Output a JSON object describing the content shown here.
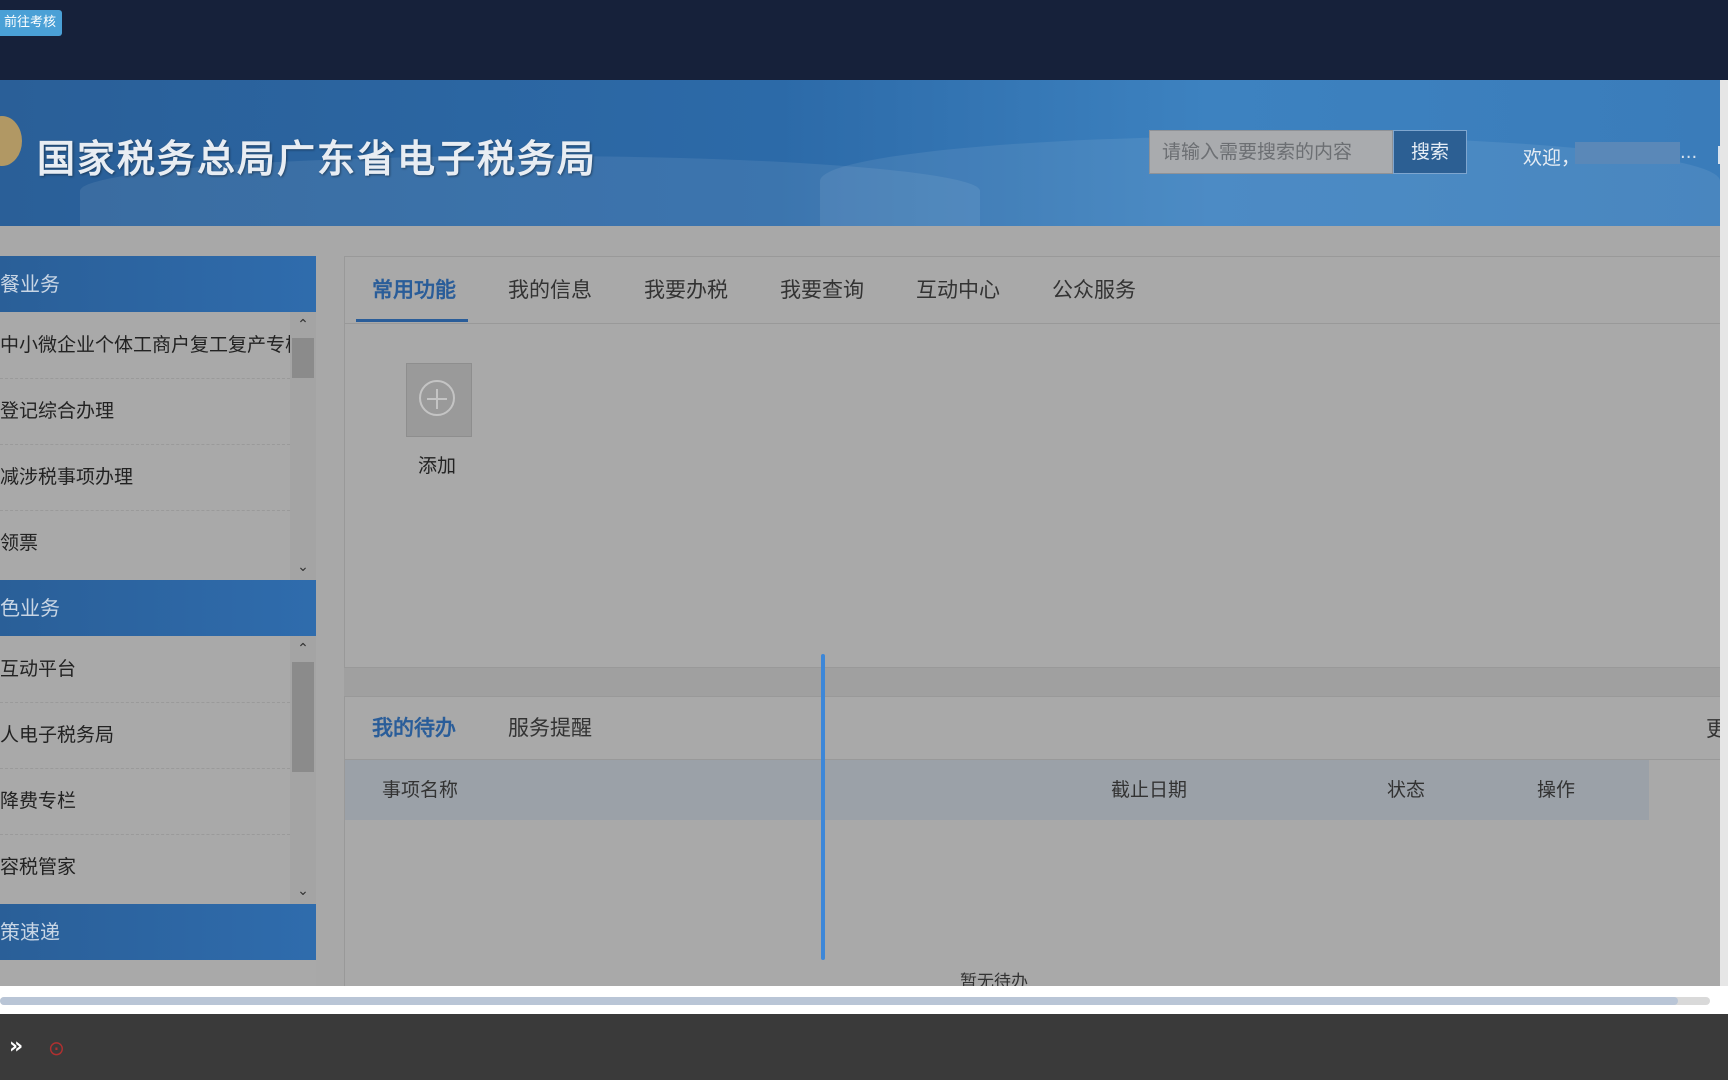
{
  "topbar": {
    "exam_button": "前往考核"
  },
  "header": {
    "site_title": "国家税务总局广东省电子税务局",
    "search_placeholder": "请输入需要搜索的内容",
    "search_button": "搜索",
    "welcome": "欢迎，",
    "username_ellipsis": "..."
  },
  "sidebar": {
    "section1": {
      "title": "餐业务",
      "items": [
        "中小微企业个体工商户复工复产专栏",
        "登记综合办理",
        "减涉税事项办理",
        "领票"
      ]
    },
    "section2": {
      "title": "色业务",
      "items": [
        "互动平台",
        "人电子税务局",
        "降费专栏",
        "容税管家"
      ]
    },
    "section3": {
      "title": "策速递"
    }
  },
  "main": {
    "tabs": [
      "常用功能",
      "我的信息",
      "我要办税",
      "我要查询",
      "互动中心",
      "公众服务"
    ],
    "add_label": "添加"
  },
  "todo": {
    "tabs": [
      "我的待办",
      "服务提醒"
    ],
    "more": "更",
    "columns": [
      "事项名称",
      "截止日期",
      "状态",
      "操作"
    ],
    "empty_text": "暂无待办"
  },
  "bottombar": {
    "arrow": "»",
    "icon": "⊙"
  },
  "colors": {
    "brand": "#2a5d99",
    "banner": "#2c6aa8",
    "topbar": "#16213a"
  }
}
